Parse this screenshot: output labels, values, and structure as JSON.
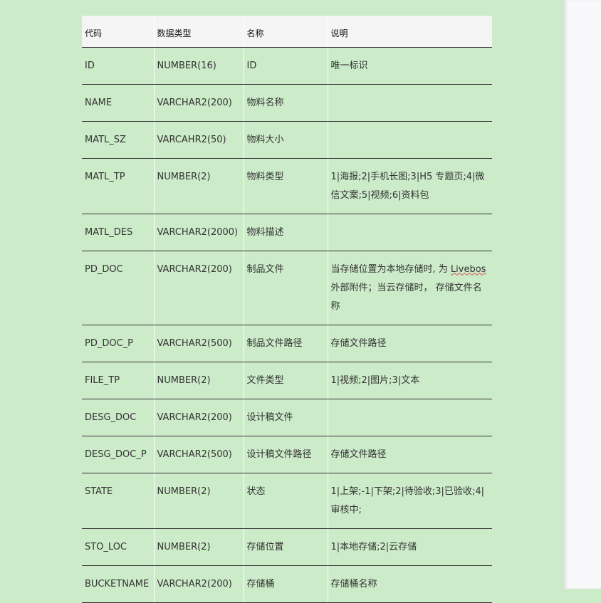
{
  "headers": [
    "代码",
    "数据类型",
    "名称",
    "说明"
  ],
  "rows": [
    {
      "code": "ID",
      "type": "NUMBER(16)",
      "name": "ID",
      "desc": "唯一标识"
    },
    {
      "code": "NAME",
      "type": "VARCHAR2(200)",
      "name": "物料名称",
      "desc": ""
    },
    {
      "code": "MATL_SZ",
      "type": "VARCAHR2(50)",
      "name": "物料大小",
      "desc": ""
    },
    {
      "code": "MATL_TP",
      "type": "NUMBER(2)",
      "name": "物料类型",
      "desc": "1|海报;2|手机长图;3|H5 专题页;4|微信文案;5|视频;6|资料包"
    },
    {
      "code": "MATL_DES",
      "type": "VARCHAR2(2000)",
      "name": "物料描述",
      "desc": ""
    },
    {
      "code": "PD_DOC",
      "type": "VARCHAR2(200)",
      "name": "制品文件",
      "desc_before": "当存储位置为本地存储时, 为 ",
      "desc_link": "Livebos",
      "desc_after": "外部附件；当云存储时， 存储文件名称"
    },
    {
      "code": "PD_DOC_P",
      "type": "VARCHAR2(500)",
      "name": "制品文件路径",
      "desc": "存储文件路径"
    },
    {
      "code": "FILE_TP",
      "type": "NUMBER(2)",
      "name": "文件类型",
      "desc": "1|视频;2|图片;3|文本"
    },
    {
      "code": "DESG_DOC",
      "type": "VARCHAR2(200)",
      "name": "设计稿文件",
      "desc": ""
    },
    {
      "code": "DESG_DOC_P",
      "type": "VARCHAR2(500)",
      "name": "设计稿文件路径",
      "desc": "存储文件路径"
    },
    {
      "code": "STATE",
      "type": "NUMBER(2)",
      "name": "状态",
      "desc": "1|上架;-1|下架;2|待验收;3|已验收;4|审核中;"
    },
    {
      "code": "STO_LOC",
      "type": "NUMBER(2)",
      "name": "存储位置",
      "desc": "1|本地存储;2|云存储"
    },
    {
      "code": "BUCKETNAME",
      "type": "VARCHAR2(200)",
      "name": "存储桶",
      "desc": "存储桶名称"
    }
  ]
}
